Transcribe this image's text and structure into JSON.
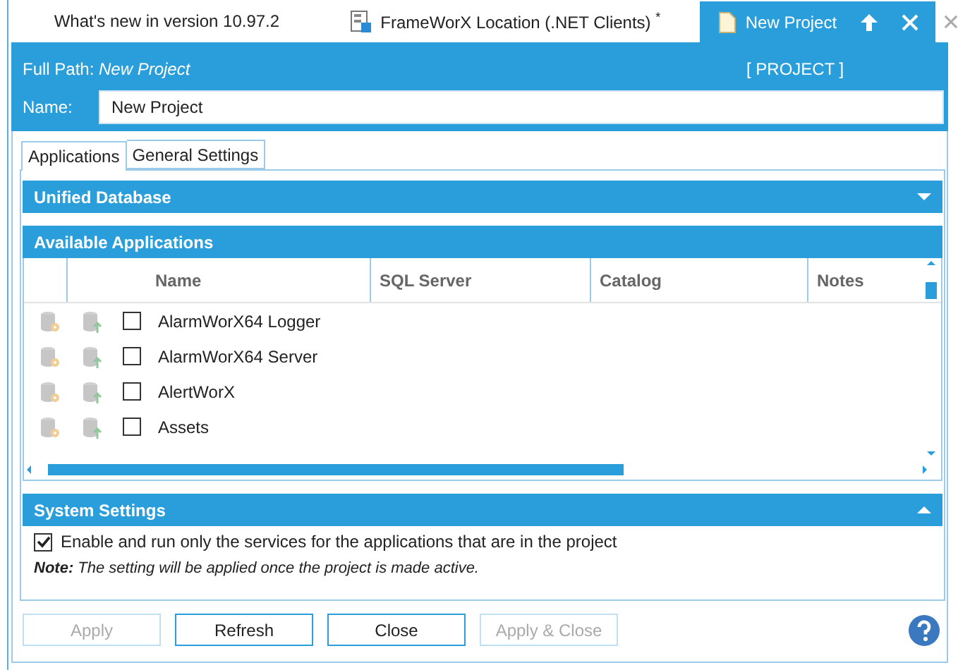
{
  "document_tabs": [
    {
      "title": "What's new in version 10.97.2",
      "kind": "plain",
      "selected": false,
      "closable": false
    },
    {
      "title": "FrameWorX Location (.NET Clients) $^{*}$",
      "kind": "location",
      "selected": false,
      "closable": false
    },
    {
      "title": "New Project",
      "kind": "project",
      "selected": true,
      "closable": true
    }
  ],
  "header": {
    "full_path_label": "Full Path:",
    "full_path": "New Project",
    "type_tag": "[ PROJECT ]",
    "name_label": "Name:",
    "name_value": "New Project"
  },
  "tabs": [
    {
      "label": "Applications",
      "selected": true
    },
    {
      "label": "General Settings",
      "selected": false
    }
  ],
  "unified_database": {
    "title": "Unified Database",
    "expanded": false
  },
  "applications": {
    "title": "Available Applications",
    "columns": [
      "Name",
      "SQL Server",
      "Catalog",
      "Notes"
    ],
    "rows": [
      {
        "name": "AlarmWorX64 Logger",
        "checked": false
      },
      {
        "name": "AlarmWorX64 Server",
        "checked": false
      },
      {
        "name": "AlertWorX",
        "checked": false
      },
      {
        "name": "Assets",
        "checked": false
      }
    ]
  },
  "system_settings": {
    "title": "System Settings",
    "expanded": true,
    "option": {
      "label": "Enable and run only the services for the applications that are in the project",
      "checked": true
    },
    "note": "**Note:** The setting will be applied once the project is made active."
  },
  "buttons": [
    {
      "label": "Apply",
      "disabled": true
    },
    {
      "label": "Refresh",
      "disabled": false
    },
    {
      "label": "Close",
      "disabled": false
    },
    {
      "label": "Apply & Close",
      "disabled": true
    }
  ]
}
